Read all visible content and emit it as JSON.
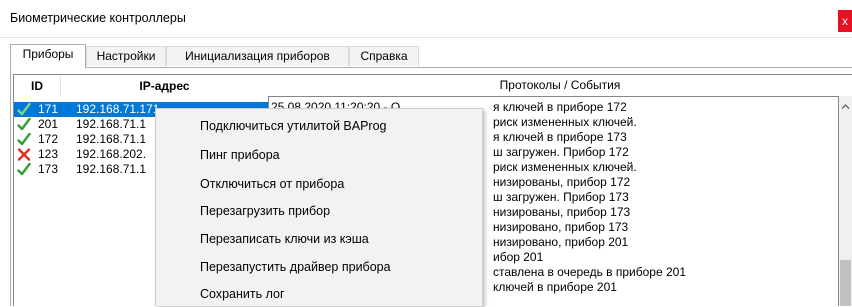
{
  "window": {
    "title": "Биометрические контроллеры",
    "close_glyph": "x"
  },
  "tabs": [
    {
      "label": "Приборы",
      "active": true
    },
    {
      "label": "Настройки",
      "active": false
    },
    {
      "label": "Инициализация приборов",
      "active": false
    },
    {
      "label": "Справка",
      "active": false
    }
  ],
  "devices": {
    "columns": {
      "id": "ID",
      "ip": "IP-адрес"
    },
    "rows": [
      {
        "status_icon": "check-icon",
        "id": "171",
        "ip": "192.168.71.171",
        "selected": true
      },
      {
        "status_icon": "check-icon",
        "id": "201",
        "ip": "192.168.71.1",
        "selected": false
      },
      {
        "status_icon": "check-icon",
        "id": "172",
        "ip": "192.168.71.1",
        "selected": false
      },
      {
        "status_icon": "cross-icon",
        "id": "123",
        "ip": "192.168.202.",
        "selected": false
      },
      {
        "status_icon": "check-icon",
        "id": "173",
        "ip": "192.168.71.1",
        "selected": false
      }
    ]
  },
  "events": {
    "header": "Протоколы / События",
    "first_line": "25.08.2020 11:20:20 - О",
    "lines": [
      "я ключей в приборе 172",
      "риск измененных ключей.",
      "я ключей в приборе 173",
      "ш загружен. Прибор 172",
      "риск измененных ключей.",
      "низированы, прибор 172",
      "ш загружен. Прибор 173",
      "низированы, прибор 173",
      "низировано, прибор 173",
      "низировано, прибор 201",
      "ибор 201",
      "ставлена в очередь в приборе 201",
      "ключей в приборе 201"
    ]
  },
  "context_menu": {
    "items": [
      "Подключиться утилитой  BAProg",
      "Пинг прибора",
      "Отключиться от прибора",
      "Перезагрузить прибор",
      "Перезаписать ключи из кэша",
      "Перезапустить драйвер прибора",
      "Сохранить лог"
    ]
  },
  "colors": {
    "selection": "#0078d7",
    "check": "#2fa12f",
    "cross": "#e0301e",
    "close": "#e81123"
  }
}
